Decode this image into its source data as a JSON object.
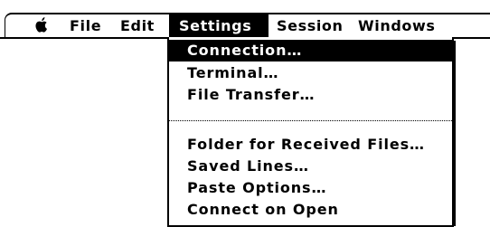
{
  "menubar": {
    "apple_icon": "apple-logo-icon",
    "items": [
      {
        "label": "File"
      },
      {
        "label": "Edit"
      },
      {
        "label": "Settings"
      },
      {
        "label": "Session"
      },
      {
        "label": "Windows"
      }
    ]
  },
  "dropdown": {
    "group1": [
      {
        "label": "Connection…"
      },
      {
        "label": "Terminal…"
      },
      {
        "label": "File Transfer…"
      }
    ],
    "group2": [
      {
        "label": "Folder for Received Files…"
      },
      {
        "label": "Saved Lines…"
      },
      {
        "label": "Paste Options…"
      },
      {
        "label": "Connect on Open"
      }
    ]
  }
}
